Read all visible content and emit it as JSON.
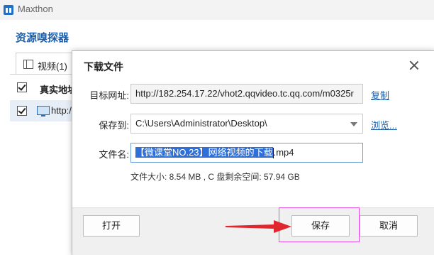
{
  "app": {
    "title": "Maxthon",
    "brand_color": "#1f6ec7"
  },
  "sniffer": {
    "heading": "资源嗅探器",
    "tab_label": "视频(1)",
    "column_header": "真实地址",
    "row_url": "http:/"
  },
  "dialog": {
    "title": "下载文件",
    "target_label": "目标网址:",
    "target_value": "http://182.254.17.22/vhot2.qqvideo.tc.qq.com/m0325r",
    "copy_link": "复制",
    "save_to_label": "保存到:",
    "save_to_value": "C:\\Users\\Administrator\\Desktop\\",
    "browse_link": "浏览...",
    "filename_label": "文件名:",
    "filename_selected": "【微课堂NO.23】网络视频的下载",
    "filename_suffix": ".mp4",
    "info": "文件大小: 8.54 MB , C 盘剩余空间: 57.94 GB",
    "open_button": "打开",
    "save_button": "保存",
    "cancel_button": "取消"
  },
  "annotation": {
    "highlight_color": "#e04fe0",
    "arrow_color": "#e0262e"
  }
}
